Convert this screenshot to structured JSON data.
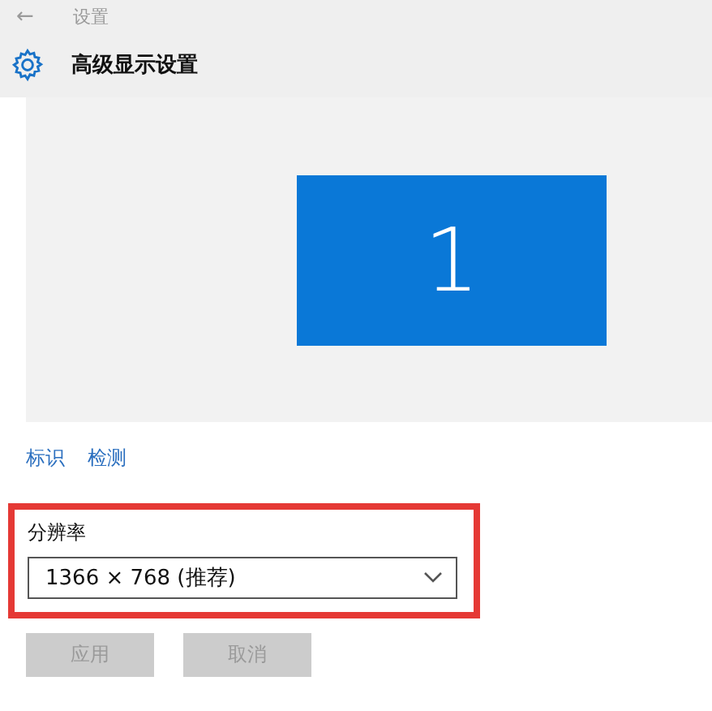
{
  "header": {
    "back": "←",
    "title": "设置"
  },
  "page": {
    "title": "高级显示设置"
  },
  "display_preview": {
    "monitors": [
      {
        "label": "1",
        "selected": true
      }
    ]
  },
  "links": [
    "标识",
    "检测"
  ],
  "resolution": {
    "label": "分辨率",
    "value": "1366 × 768 (推荐)"
  },
  "buttons": [
    {
      "label": "应用",
      "disabled": true
    },
    {
      "label": "取消",
      "disabled": true
    }
  ]
}
